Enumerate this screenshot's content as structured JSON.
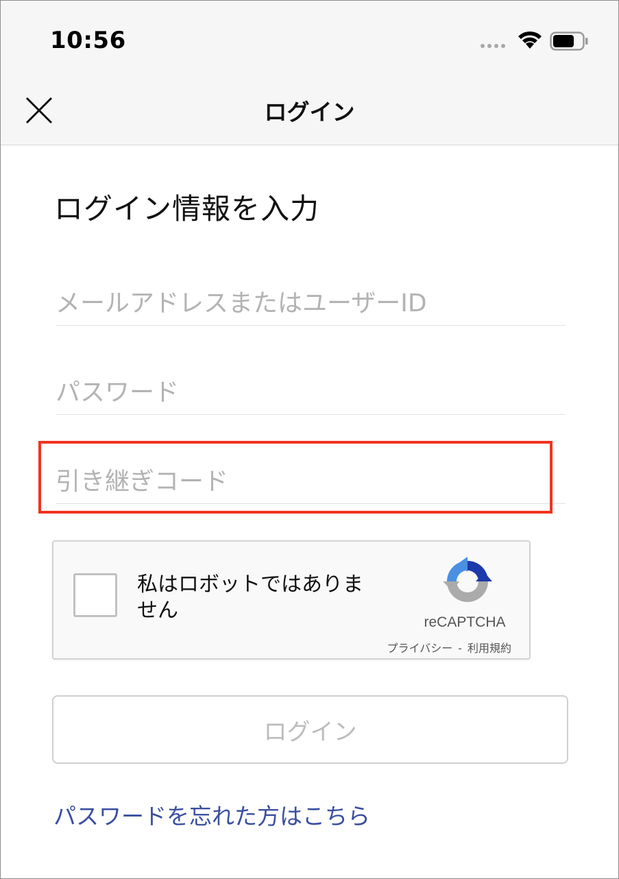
{
  "status_bar": {
    "time": "10:56",
    "signal_icon": "cellular-signal-icon",
    "wifi_icon": "wifi-icon",
    "battery_icon": "battery-icon"
  },
  "nav": {
    "title": "ログイン",
    "close_icon": "close-icon"
  },
  "form": {
    "heading": "ログイン情報を入力",
    "email_placeholder": "メールアドレスまたはユーザーID",
    "email_value": "",
    "password_placeholder": "パスワード",
    "password_value": "",
    "transfer_code_placeholder": "引き継ぎコード",
    "transfer_code_value": ""
  },
  "recaptcha": {
    "label": "私はロボットではありません",
    "brand": "reCAPTCHA",
    "privacy_link": "プライバシー",
    "separator": "-",
    "terms_link": "利用規約",
    "logo_icon": "recaptcha-logo-icon",
    "checked": false
  },
  "actions": {
    "login_label": "ログイン",
    "forgot_password_link": "パスワードを忘れた方はこちら"
  },
  "colors": {
    "highlight": "#f2321f",
    "link": "#3a4fa0",
    "recaptcha_blue": "#1c3aa9",
    "recaptcha_lightblue": "#4a90e2",
    "recaptcha_grey": "#ababab"
  }
}
